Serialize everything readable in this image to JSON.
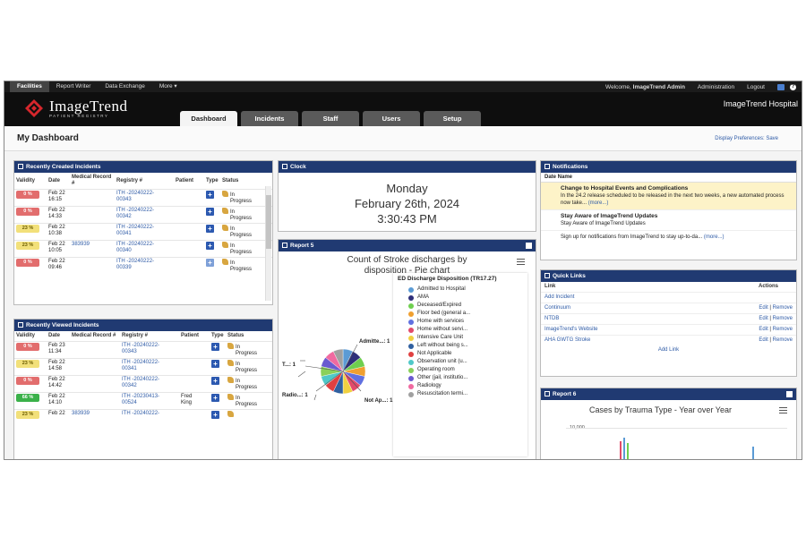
{
  "topbar": {
    "nav": [
      "Facilities",
      "Report Writer",
      "Data Exchange",
      "More ▾"
    ],
    "welcome_prefix": "Welcome,",
    "welcome_user": "ImageTrend Admin",
    "administration": "Administration",
    "logout": "Logout"
  },
  "header": {
    "brand": "ImageTrend",
    "subbrand": "PATIENT REGISTRY",
    "hospital": "ImageTrend Hospital",
    "tabs": [
      "Dashboard",
      "Incidents",
      "Staff",
      "Users",
      "Setup"
    ]
  },
  "page": {
    "title": "My Dashboard",
    "prefs_label": "Display Preferences",
    "prefs_sep": ":",
    "prefs_save": "Save"
  },
  "recent_created": {
    "title": "Recently Created Incidents",
    "columns": [
      "Validity",
      "Date",
      "Medical Record #",
      "Registry #",
      "Patient",
      "Type",
      "Status"
    ],
    "rows": [
      {
        "validity": "0 %",
        "vcolor": "red",
        "date": "Feb 22",
        "time": "16:15",
        "mrn": "",
        "reg1": "ITH -20240222-",
        "reg2": "00343",
        "patient": "",
        "status1": "In",
        "status2": "Progress"
      },
      {
        "validity": "0 %",
        "vcolor": "red",
        "date": "Feb 22",
        "time": "14:33",
        "mrn": "",
        "reg1": "ITH -20240222-",
        "reg2": "00342",
        "patient": "",
        "status1": "In",
        "status2": "Progress"
      },
      {
        "validity": "23 %",
        "vcolor": "yellow",
        "date": "Feb 22",
        "time": "10:38",
        "mrn": "",
        "reg1": "ITH -20240222-",
        "reg2": "00341",
        "patient": "",
        "status1": "In",
        "status2": "Progress"
      },
      {
        "validity": "23 %",
        "vcolor": "yellow",
        "date": "Feb 22",
        "time": "10:05",
        "mrn": "383939",
        "reg1": "ITH -20240222-",
        "reg2": "00340",
        "patient": "",
        "status1": "In",
        "status2": "Progress"
      },
      {
        "validity": "0 %",
        "vcolor": "red",
        "date": "Feb 22",
        "time": "09:46",
        "mrn": "",
        "reg1": "ITH -20240222-",
        "reg2": "00339",
        "patient": "",
        "status1": "In",
        "status2": "Progress"
      }
    ]
  },
  "recent_viewed": {
    "title": "Recently Viewed Incidents",
    "columns": [
      "Validity",
      "Date",
      "Medical Record #",
      "Registry #",
      "Patient",
      "Type",
      "Status"
    ],
    "rows": [
      {
        "validity": "0 %",
        "vcolor": "red",
        "date": "Feb 23",
        "time": "11:34",
        "mrn": "",
        "reg1": "ITH -20240222-",
        "reg2": "00343",
        "patient": "",
        "patient2": "",
        "status1": "In",
        "status2": "Progress"
      },
      {
        "validity": "23 %",
        "vcolor": "yellow",
        "date": "Feb 22",
        "time": "14:58",
        "mrn": "",
        "reg1": "ITH -20240222-",
        "reg2": "00341",
        "patient": "",
        "patient2": "",
        "status1": "In",
        "status2": "Progress"
      },
      {
        "validity": "0 %",
        "vcolor": "red",
        "date": "Feb 22",
        "time": "14:42",
        "mrn": "",
        "reg1": "ITH -20240222-",
        "reg2": "00342",
        "patient": "",
        "patient2": "",
        "status1": "In",
        "status2": "Progress"
      },
      {
        "validity": "66 %",
        "vcolor": "green",
        "date": "Feb 22",
        "time": "14:10",
        "mrn": "",
        "reg1": "ITH -20230413-",
        "reg2": "00524",
        "patient": "Fred",
        "patient2": "King",
        "status1": "In",
        "status2": "Progress"
      },
      {
        "validity": "23 %",
        "vcolor": "yellow",
        "date": "Feb 22",
        "time": "",
        "mrn": "383939",
        "reg1": "ITH -20240222-",
        "reg2": "",
        "patient": "",
        "patient2": "",
        "status1": "",
        "status2": ""
      }
    ]
  },
  "clock": {
    "title": "Clock",
    "day": "Monday",
    "date": "February 26th, 2024",
    "time": "3:30:43 PM"
  },
  "report5": {
    "title": "Report 5",
    "chart_title_1": "Count of Stroke discharges by",
    "chart_title_2": "disposition - Pie chart",
    "legend_title": "ED Discharge Disposition (TR17.27)",
    "labels": [
      "Admitte...: 1",
      "T...: 1",
      "Radio...: 1",
      "Not Ap...: 1"
    ]
  },
  "chart_data": [
    {
      "type": "pie",
      "title": "Count of Stroke discharges by disposition - Pie chart",
      "legend_title": "ED Discharge Disposition (TR17.27)",
      "categories": [
        "Admitted to Hospital",
        "AMA",
        "Deceased/Expired",
        "Floor bed (general a...",
        "Home with services",
        "Home without servi...",
        "Intensive Care Unit",
        "Left without being s...",
        "Not Applicable",
        "Observation unit (u...",
        "Operating room",
        "Other (jail, institutio...",
        "Radiology",
        "Resuscitation termi..."
      ],
      "colors": [
        "#5b9bd5",
        "#2f2f7a",
        "#6fcf4f",
        "#f0a030",
        "#6070e0",
        "#e24a6a",
        "#f0d040",
        "#3060a0",
        "#e04040",
        "#50c8c8",
        "#8ad05a",
        "#6a5ad0",
        "#f06aa0",
        "#a0a0a0"
      ],
      "values": [
        1,
        1,
        1,
        1,
        1,
        1,
        1,
        1,
        1,
        1,
        1,
        1,
        1,
        1
      ],
      "legend_placement": "right"
    },
    {
      "type": "bar",
      "title": "Cases by Trauma Type - Year over Year",
      "yticks": [
        "10,000"
      ],
      "categories": [],
      "values": []
    }
  ],
  "notifications": {
    "title": "Notifications",
    "col_header": "Date Name",
    "items": [
      {
        "title": "Change to Hospital Events and Complications",
        "body": "In the 24.2 release scheduled to be released in the next two weeks, a new automated process now take...",
        "more": "(more...)"
      },
      {
        "title": "Stay Aware of ImageTrend Updates",
        "body": "Stay Aware of ImageTrend Updates",
        "more": ""
      }
    ],
    "signup": "Sign up for notifications from ImageTrend to stay up-to-da...",
    "signup_more": "(more...)"
  },
  "quick_links": {
    "title": "Quick Links",
    "col_link": "Link",
    "col_actions": "Actions",
    "items": [
      {
        "label": "Add Incident",
        "edit": "",
        "remove": ""
      },
      {
        "label": "Continuum",
        "edit": "Edit",
        "remove": "Remove"
      },
      {
        "label": "NTDB",
        "edit": "Edit",
        "remove": "Remove"
      },
      {
        "label": "ImageTrend's Website",
        "edit": "Edit",
        "remove": "Remove"
      },
      {
        "label": "AHA GWTG Stroke",
        "edit": "Edit",
        "remove": "Remove"
      }
    ],
    "sep": "|",
    "add_link": "Add Link"
  },
  "report6": {
    "title": "Report 6",
    "chart_title": "Cases by Trauma Type - Year over Year",
    "ytick": "10,000"
  }
}
